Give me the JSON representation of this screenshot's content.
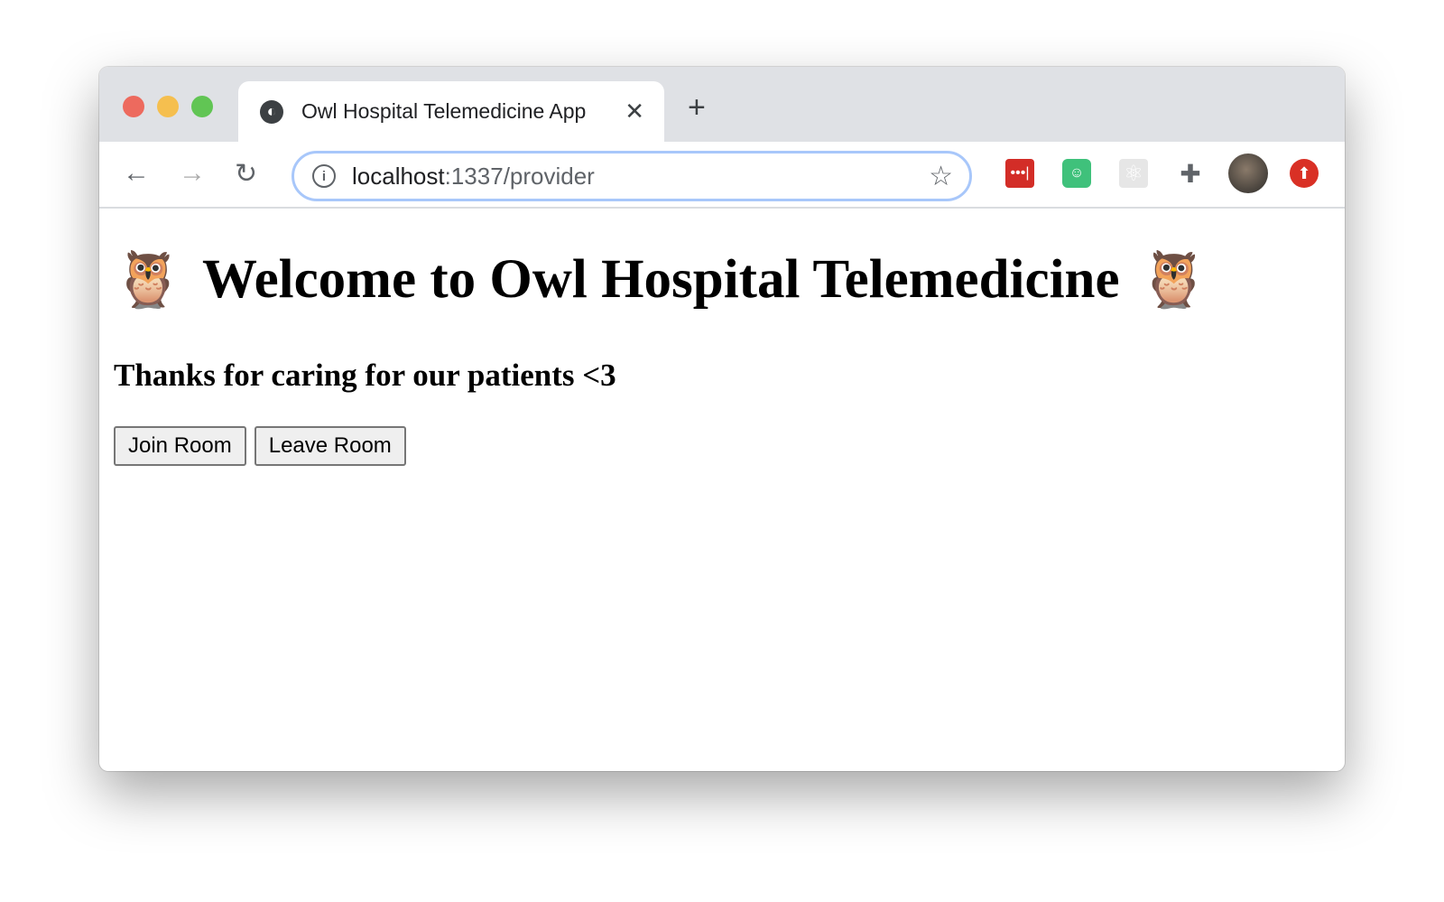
{
  "browser": {
    "tab_title": "Owl Hospital Telemedicine App",
    "url_host": "localhost",
    "url_path": ":1337/provider",
    "extensions": [
      "lastpass-icon",
      "bitmoji-icon",
      "react-devtools-icon",
      "extensions-puzzle-icon",
      "profile-avatar",
      "update-icon"
    ]
  },
  "page": {
    "owl": "🦉",
    "heading": "Welcome to Owl Hospital Telemedicine",
    "subheading": "Thanks for caring for our patients <3",
    "buttons": {
      "join": "Join Room",
      "leave": "Leave Room"
    }
  },
  "colors": {
    "lastpass": "#d32d27",
    "bitmoji": "#3fc17b",
    "update": "#d93025",
    "focus_ring": "#a8c7fa"
  }
}
